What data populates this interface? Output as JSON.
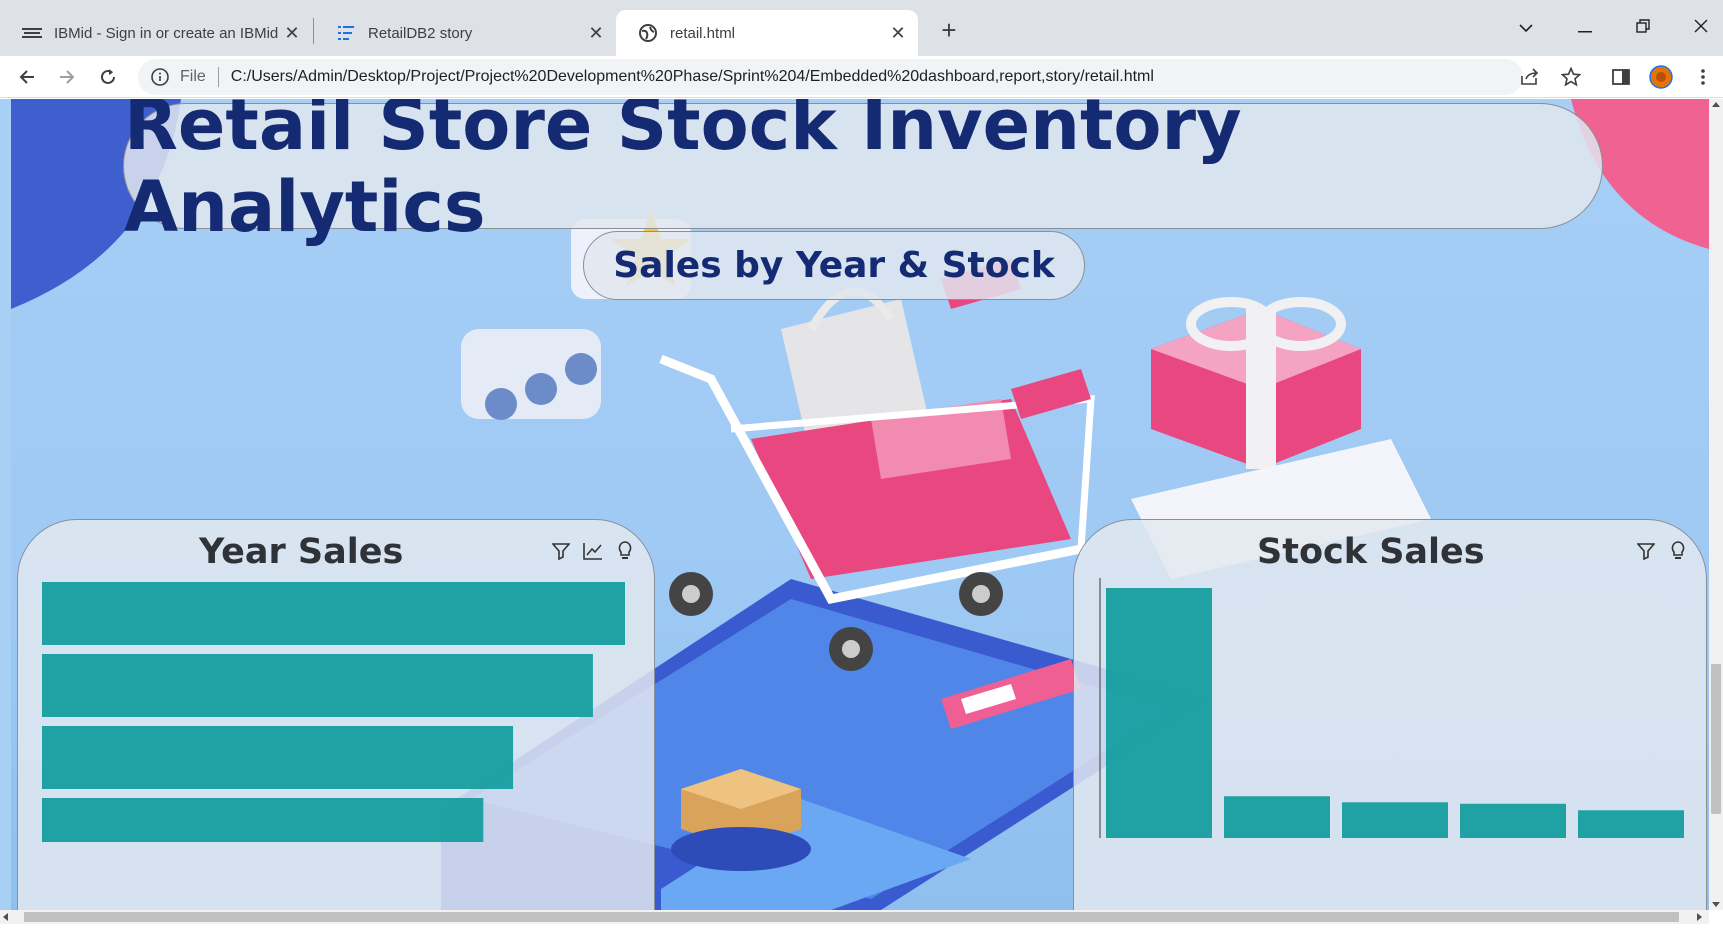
{
  "browser": {
    "tabs": [
      {
        "title": "IBMid - Sign in or create an IBMid",
        "active": false
      },
      {
        "title": "RetailDB2 story",
        "active": false
      },
      {
        "title": "retail.html",
        "active": true
      }
    ],
    "new_tab_label": "+",
    "address": {
      "scheme": "File",
      "url": "C:/Users/Admin/Desktop/Project/Project%20Development%20Phase/Sprint%204/Embedded%20dashboard,report,story/retail.html"
    }
  },
  "page": {
    "title": "Retail Store Stock Inventory Analytics",
    "subtitle": "Sales by Year & Stock"
  },
  "panels": {
    "year_sales": {
      "title": "Year Sales",
      "icons": [
        "filter-icon",
        "insights-chart-icon",
        "lightbulb-icon"
      ]
    },
    "stock_sales": {
      "title": "Stock Sales",
      "icons": [
        "filter-icon",
        "lightbulb-icon"
      ]
    }
  },
  "colors": {
    "bar": "#169ea0",
    "title_text": "#142b73",
    "accent_pink": "#e8477f"
  },
  "chart_data": [
    {
      "type": "bar",
      "orientation": "horizontal",
      "title": "Year Sales",
      "categories": [
        "",
        "",
        "",
        ""
      ],
      "values": [
        100,
        94.5,
        80.8,
        75.7
      ],
      "note": "relative bar lengths; labels not visible"
    },
    {
      "type": "bar",
      "orientation": "vertical",
      "title": "Stock Sales",
      "categories": [
        "",
        "",
        "",
        "",
        ""
      ],
      "values": [
        100,
        16.7,
        14.3,
        13.7,
        11.1
      ]
    }
  ]
}
